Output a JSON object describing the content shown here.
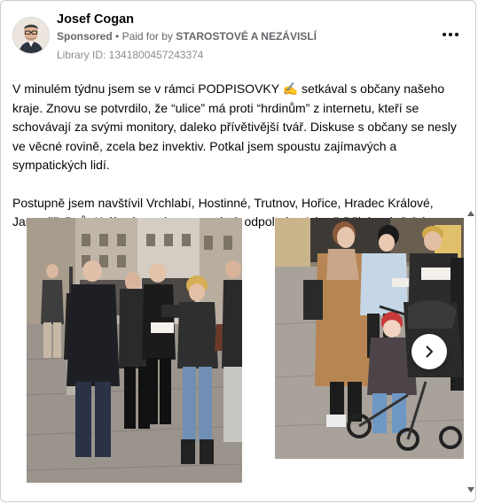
{
  "post": {
    "author": "Josef Cogan",
    "sponsored_label": "Sponsored",
    "paid_for_text": "Paid for by",
    "payer": "STAROSTOVÉ A NEZÁVISLÍ",
    "library_id": "Library ID: 1341800457243374",
    "paragraph1": "V minulém týdnu jsem se v rámci PODPISOVKY ✍️ setkával s občany našeho kraje. Znovu se potvrdilo, že “ulice” má proti “hrdinům” z internetu, kteří se schovávají za svými monitory, daleko přívětivější tvář. Diskuse s občany se nesly ve věcné rovině, zcela bez invektiv. Potkal jsem spoustu zajímavých a sympatických lidí.",
    "paragraph2": "Postupně jsem navštívil Vrchlabí, Hostinné, Trutnov, Hořice, Hradec Králové, Jaroměř, Dvůr Králové a nakonec v pátek odpoledne Lázně Bělohrad. Jak jsem se těšil, tak jsem i dopadl – všude mě lidé vítali s úsměvem."
  },
  "icons": {
    "more": "more-options-icon",
    "next": "chevron-right-icon",
    "scroll_up": "scroll-up-arrow-icon",
    "scroll_down": "scroll-down-arrow-icon"
  },
  "colors": {
    "text_primary": "#050505",
    "text_secondary": "#65676b",
    "border": "#c9ccd1"
  }
}
